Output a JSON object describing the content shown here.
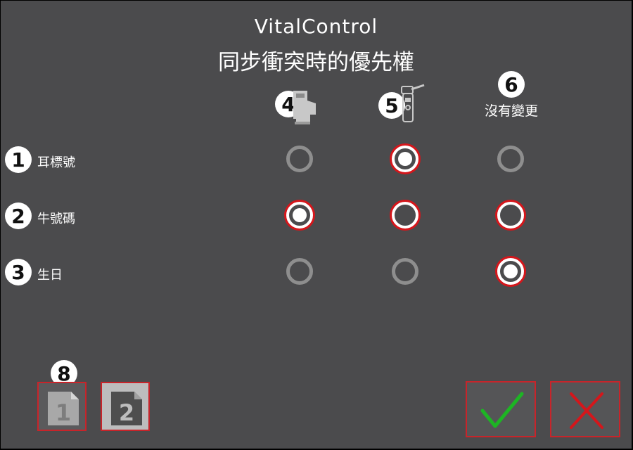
{
  "header": {
    "app_title": "VitalControl",
    "subtitle": "同步衝突時的優先權"
  },
  "columns": [
    {
      "badge": "4",
      "icon": "scale-unit-icon",
      "label": ""
    },
    {
      "badge": "5",
      "icon": "handheld-reader-icon",
      "label": ""
    },
    {
      "badge": "6",
      "icon": "",
      "label": "沒有變更"
    }
  ],
  "rows": [
    {
      "badge": "1",
      "label": "耳標號",
      "options": [
        {
          "state": "disabled",
          "checked": false
        },
        {
          "state": "enabled",
          "checked": true
        },
        {
          "state": "disabled",
          "checked": false
        }
      ]
    },
    {
      "badge": "2",
      "label": "牛號碼",
      "options": [
        {
          "state": "enabled",
          "checked": true
        },
        {
          "state": "enabled",
          "checked": false
        },
        {
          "state": "enabled",
          "checked": false
        }
      ]
    },
    {
      "badge": "3",
      "label": "生日",
      "options": [
        {
          "state": "disabled",
          "checked": false
        },
        {
          "state": "disabled",
          "checked": false
        },
        {
          "state": "enabled",
          "checked": true
        }
      ]
    }
  ],
  "pager": {
    "badge": "8",
    "pages": [
      {
        "label": "1",
        "active": false
      },
      {
        "label": "2",
        "active": true
      }
    ]
  },
  "actions": {
    "confirm_icon": "checkmark-icon",
    "cancel_icon": "close-icon"
  },
  "colors": {
    "background": "#4b4b4d",
    "accent_red": "#d5161b",
    "confirm_green": "#1db524",
    "disabled_gray": "#8e8e8e"
  }
}
